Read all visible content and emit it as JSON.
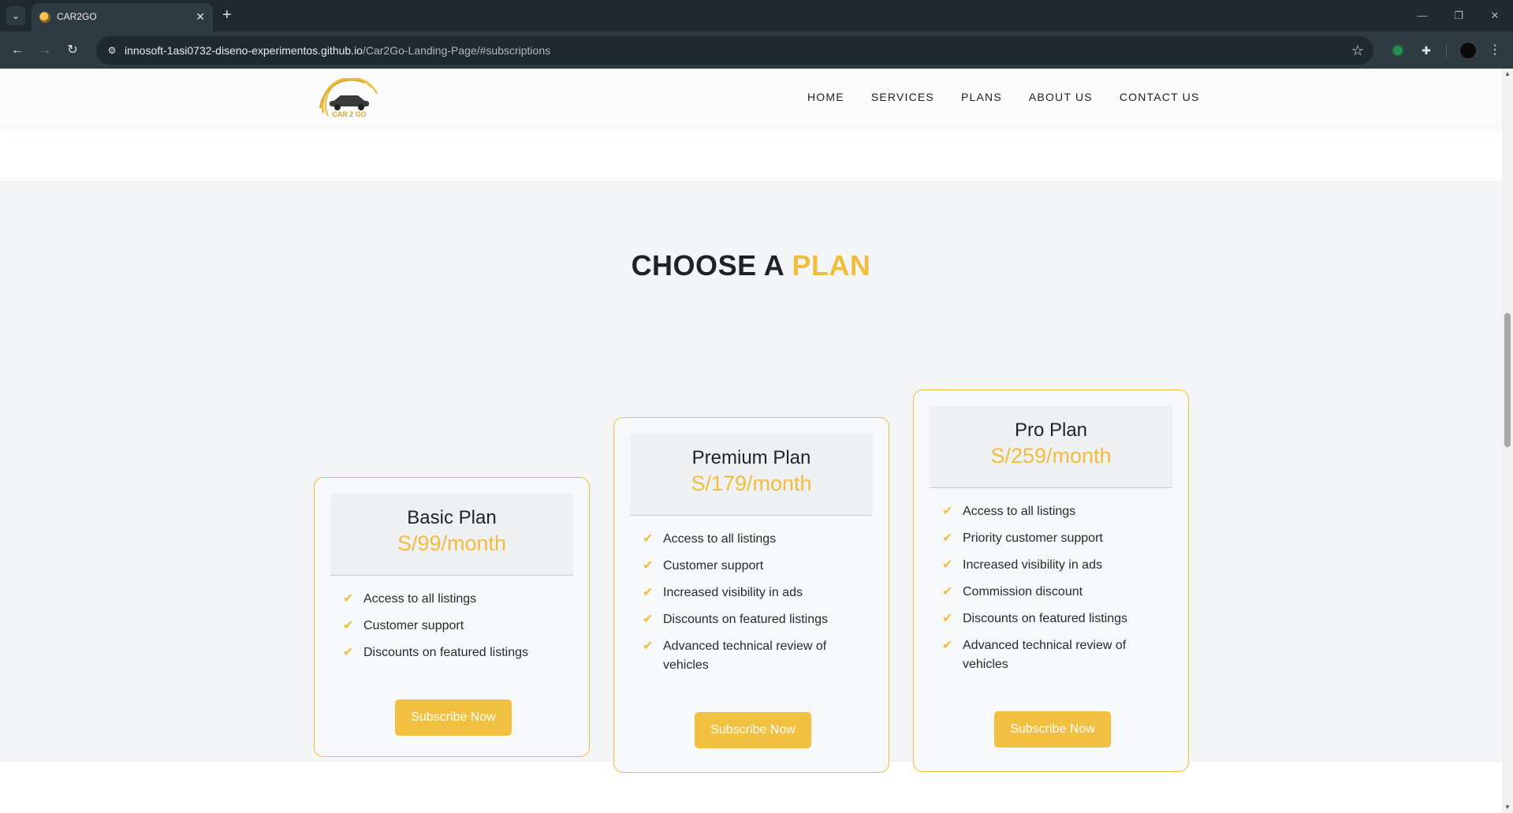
{
  "browser": {
    "tab_title": "CAR2GO",
    "url_host": "innosoft-1asi0732-diseno-experimentos.github.io",
    "url_path": "/Car2Go-Landing-Page/#subscriptions",
    "icons": {
      "tab_menu": "chevron-down-icon",
      "close_tab": "close-icon",
      "new_tab": "plus-icon",
      "back": "arrow-left-icon",
      "forward": "arrow-right-icon",
      "reload": "reload-icon",
      "site_info": "site-info-icon",
      "bookmark": "star-icon",
      "extension": "puzzle-icon",
      "menu": "kebab-icon"
    },
    "glyphs": {
      "tab_menu": "⌄",
      "close_tab": "✕",
      "new_tab": "+",
      "back": "←",
      "forward": "→",
      "reload": "↻",
      "site_info": "⚙",
      "bookmark": "☆",
      "extension": "✚",
      "menu": "⋮",
      "minimize": "—",
      "maximize": "❐",
      "close_window": "✕"
    }
  },
  "site": {
    "logo_text": "CAR 2 GO",
    "nav": [
      "HOME",
      "SERVICES",
      "PLANS",
      "ABOUT US",
      "CONTACT US"
    ]
  },
  "section": {
    "title_main": "CHOOSE A ",
    "title_accent": "PLAN"
  },
  "plans": [
    {
      "name": "Basic Plan",
      "price": "S/99/month",
      "features": [
        "Access to all listings",
        "Customer support",
        "Discounts on featured listings"
      ],
      "button": "Subscribe Now"
    },
    {
      "name": "Premium Plan",
      "price": "S/179/month",
      "features": [
        "Access to all listings",
        "Customer support",
        "Increased visibility in ads",
        "Discounts on featured listings",
        "Advanced technical review of vehicles"
      ],
      "button": "Subscribe Now"
    },
    {
      "name": "Pro Plan",
      "price": "S/259/month",
      "features": [
        "Access to all listings",
        "Priority customer support",
        "Increased visibility in ads",
        "Commission discount",
        "Discounts on featured listings",
        "Advanced technical review of vehicles"
      ],
      "button": "Subscribe Now"
    }
  ],
  "check_glyph": "✔",
  "colors": {
    "accent": "#f0bd3e",
    "button": "#f2c040",
    "heading": "#1f2228",
    "section_bg": "#f4f5f6",
    "browser_dark": "#1f2a30",
    "browser_toolbar": "#2f3b42"
  }
}
